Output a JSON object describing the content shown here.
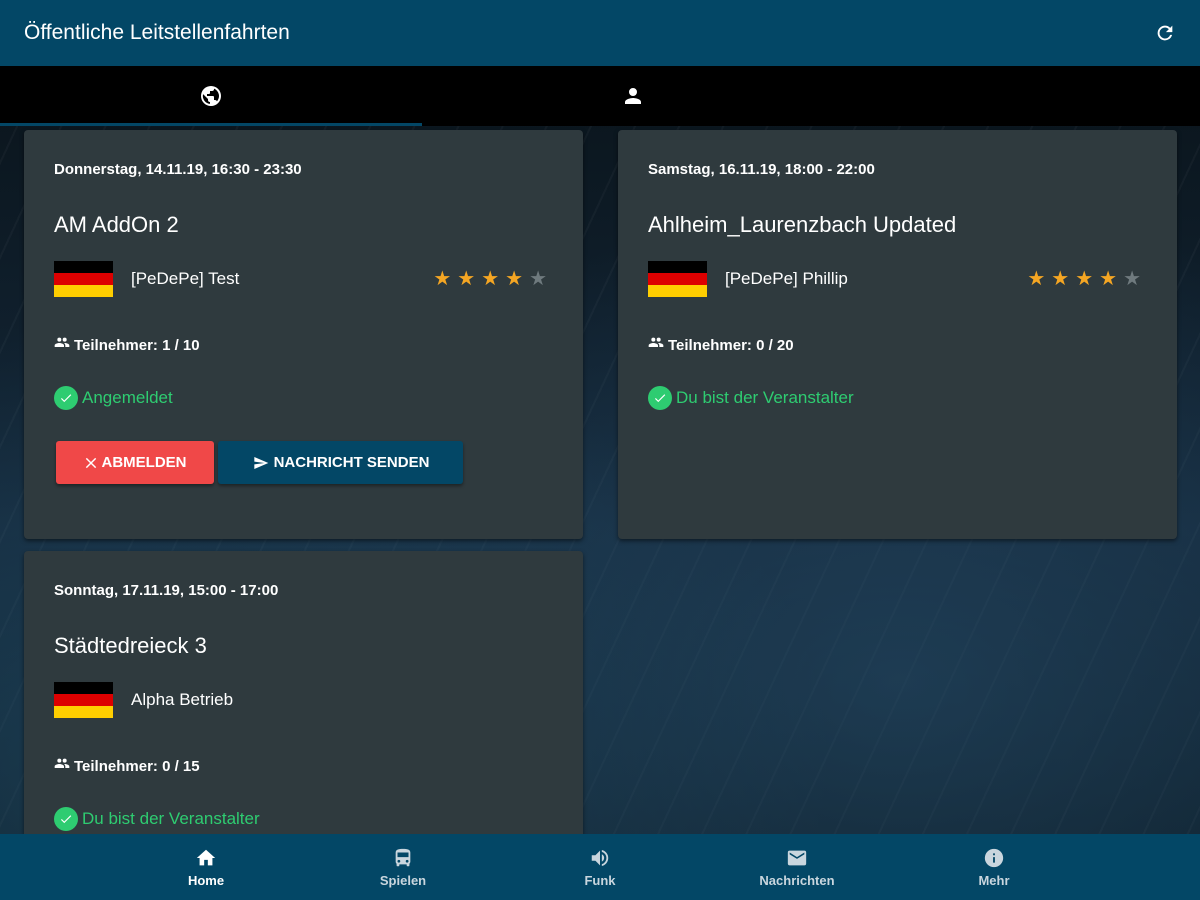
{
  "header": {
    "title": "Öffentliche Leitstellenfahrten",
    "refresh_icon": "refresh-icon"
  },
  "tabs": [
    {
      "icon": "globe-icon",
      "active": true
    },
    {
      "icon": "person-icon",
      "active": false
    }
  ],
  "cards": [
    {
      "date": "Donnerstag, 14.11.19, 16:30 - 23:30",
      "title": "AM AddOn 2",
      "owner": "[PeDePe] Test",
      "rating": 4,
      "participants": "Teilnehmer: 1 / 10",
      "status": "Angemeldet",
      "actions": {
        "unregister": "ABMELDEN",
        "message": "NACHRICHT SENDEN"
      }
    },
    {
      "date": "Samstag, 16.11.19, 18:00 - 22:00",
      "title": "Ahlheim_Laurenzbach Updated",
      "owner": "[PeDePe] Phillip",
      "rating": 4,
      "participants": "Teilnehmer: 0 / 20",
      "status": "Du bist der Veranstalter"
    },
    {
      "date": "Sonntag, 17.11.19, 15:00 - 17:00",
      "title": "Städtedreieck 3",
      "owner": "Alpha Betrieb",
      "participants": "Teilnehmer: 0 / 15",
      "status": "Du bist der Veranstalter"
    }
  ],
  "bottom_nav": [
    {
      "label": "Home",
      "icon": "home-icon",
      "active": true
    },
    {
      "label": "Spielen",
      "icon": "bus-icon",
      "active": false
    },
    {
      "label": "Funk",
      "icon": "speaker-icon",
      "active": false
    },
    {
      "label": "Nachrichten",
      "icon": "mail-icon",
      "active": false
    },
    {
      "label": "Mehr",
      "icon": "info-icon",
      "active": false
    }
  ],
  "colors": {
    "primary": "#034766",
    "card": "#2f3a3e",
    "success": "#2ecc71",
    "danger": "#f04848",
    "star": "#f5a623"
  }
}
